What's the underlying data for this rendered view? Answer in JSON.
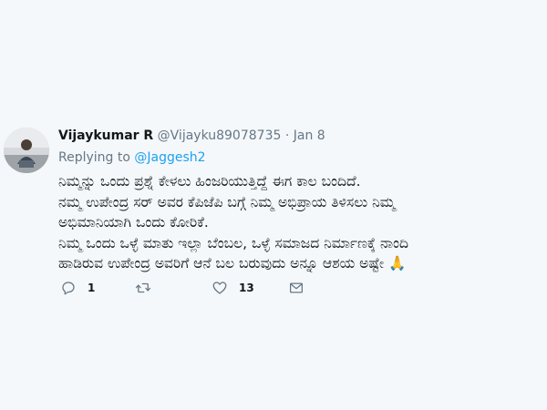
{
  "tweet": {
    "display_name": "Vijaykumar R",
    "handle": "@Vijayku89078735",
    "separator": "·",
    "date": "Jan 8",
    "replying_prefix": "Replying to",
    "replying_to": "@Jaggesh2",
    "text_lines": [
      "ನಿಮ್ಮನ್ನು ಒಂದು ಪ್ರಶ್ನೆ ಕೇಳಲು ಹಿಂಜರಿಯುತ್ತಿದ್ದೆ ಈಗ ಕಾಲ ಬಂದಿದೆ.",
      "ನಮ್ಮ ಉಪೇಂದ್ರ ಸರ್ ಅವರ ಕೆಪಿಜೆಪಿ ಬಗ್ಗೆ ನಿಮ್ಮ ಅಭಿಪ್ರಾಯ ತಿಳಿಸಲು ನಿಮ್ಮ",
      "ಅಭಿಮಾನಿಯಾಗಿ ಒಂದು ಕೋರಿಕೆ.",
      "ನಿಮ್ಮ ಒಂದು ಒಳ್ಳೆ ಮಾತು ಇಲ್ಲಾ ಬೆಂಬಲ, ಒಳ್ಳೆ ಸಮಾಜದ ನಿರ್ಮಾಣಕ್ಕೆ ನಾಂದಿ",
      "ಹಾಡಿರುವ ಉಪೇಂದ್ರ ಅವರಿಗೆ ಆನೆ ಬಲ ಬರುವುದು ಅನ್ನೂ ಆಶಯ ಅಷ್ಟೇ"
    ],
    "emoji": "🙏",
    "actions": {
      "reply_count": "1",
      "retweet_count": "",
      "like_count": "13"
    },
    "icons": {
      "reply": "reply-icon",
      "retweet": "retweet-icon",
      "like": "heart-icon",
      "dm": "envelope-icon"
    }
  }
}
